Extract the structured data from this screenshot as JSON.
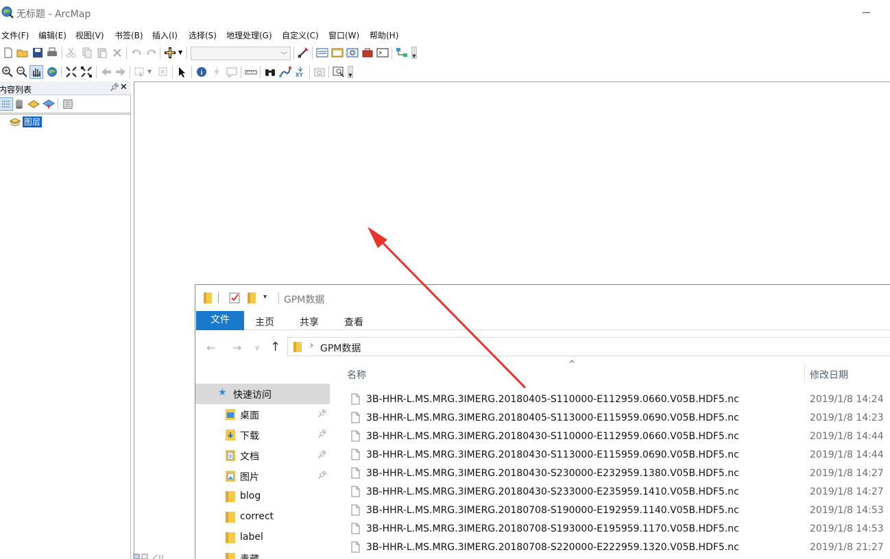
{
  "window": {
    "title": "无标题 - ArcMap"
  },
  "menubar": {
    "items": [
      "文件(F)",
      "编辑(E)",
      "视图(V)",
      "书签(B)",
      "插入(I)",
      "选择(S)",
      "地理处理(G)",
      "自定义(C)",
      "窗口(W)",
      "帮助(H)"
    ]
  },
  "toolbar": {
    "scale_value": ""
  },
  "toc": {
    "title": "内容列表",
    "pin_icon": "pin-icon",
    "close_icon": "close-icon",
    "layer_label": "图层"
  },
  "explorer": {
    "title": "GPM数据",
    "ribbon_tabs": [
      "文件",
      "主页",
      "共享",
      "查看"
    ],
    "address": {
      "path_item": "GPM数据"
    },
    "nav": {
      "quick_access": "快速访问",
      "items": [
        {
          "label": "桌面",
          "icon": "desktop-folder-icon",
          "pinned": true
        },
        {
          "label": "下载",
          "icon": "download-folder-icon",
          "pinned": true
        },
        {
          "label": "文档",
          "icon": "documents-folder-icon",
          "pinned": true
        },
        {
          "label": "图片",
          "icon": "pictures-folder-icon",
          "pinned": true
        },
        {
          "label": "blog",
          "icon": "folder-icon",
          "pinned": false
        },
        {
          "label": "correct",
          "icon": "folder-icon",
          "pinned": false
        },
        {
          "label": "label",
          "icon": "folder-icon",
          "pinned": false
        },
        {
          "label": "青藏",
          "icon": "folder-icon",
          "pinned": false
        }
      ]
    },
    "columns": {
      "name": "名称",
      "date": "修改日期"
    },
    "files": [
      {
        "name": "3B-HHR-L.MS.MRG.3IMERG.20180405-S110000-E112959.0660.V05B.HDF5.nc",
        "date": "2019/1/8 14:24"
      },
      {
        "name": "3B-HHR-L.MS.MRG.3IMERG.20180405-S113000-E115959.0690.V05B.HDF5.nc",
        "date": "2019/1/8 14:23"
      },
      {
        "name": "3B-HHR-L.MS.MRG.3IMERG.20180430-S110000-E112959.0660.V05B.HDF5.nc",
        "date": "2019/1/8 14:44"
      },
      {
        "name": "3B-HHR-L.MS.MRG.3IMERG.20180430-S113000-E115959.0690.V05B.HDF5.nc",
        "date": "2019/1/8 14:44"
      },
      {
        "name": "3B-HHR-L.MS.MRG.3IMERG.20180430-S230000-E232959.1380.V05B.HDF5.nc",
        "date": "2019/1/8 14:27"
      },
      {
        "name": "3B-HHR-L.MS.MRG.3IMERG.20180430-S233000-E235959.1410.V05B.HDF5.nc",
        "date": "2019/1/8 14:27"
      },
      {
        "name": "3B-HHR-L.MS.MRG.3IMERG.20180708-S190000-E192959.1140.V05B.HDF5.nc",
        "date": "2019/1/8 14:53"
      },
      {
        "name": "3B-HHR-L.MS.MRG.3IMERG.20180708-S193000-E195959.1170.V05B.HDF5.nc",
        "date": "2019/1/8 14:53"
      },
      {
        "name": "3B-HHR-L.MS.MRG.3IMERG.20180708-S220000-E222959.1320.V05B.HDF5.nc",
        "date": "2019/1/8 21:27"
      }
    ]
  },
  "colors": {
    "accent": "#1979ca",
    "selection": "#0a64d8",
    "annotation_arrow": "#e8322b"
  }
}
